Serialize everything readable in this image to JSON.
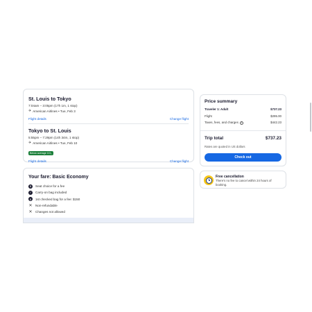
{
  "flights": [
    {
      "title": "St. Louis to Tokyo",
      "time": "7:04am – 3:05pm (17h 1m, 1 stop)",
      "airline": "American Airlines • Tue, Feb 3",
      "details_link": "Flight details",
      "change_link": "Change flight",
      "badge": ""
    },
    {
      "title": "Tokyo to St. Louis",
      "time": "5:55pm – 7:29pm (14h 34m, 1 stop)",
      "airline": "American Airlines • Tue, Feb 10",
      "details_link": "Flight details",
      "change_link": "Change flight",
      "badge": "Below average CO₂"
    }
  ],
  "fare": {
    "title": "Your fare: Basic Economy",
    "features": [
      {
        "icon": "dollar-icon",
        "text": "Seat choice for a fee"
      },
      {
        "icon": "check-icon",
        "text": "Carry-on bag included"
      },
      {
        "icon": "dollar-icon",
        "text": "1st checked bag for a fee: $150"
      },
      {
        "icon": "x-icon",
        "text": "Non-refundable"
      },
      {
        "icon": "x-icon",
        "text": "Changes not allowed"
      }
    ]
  },
  "price_summary": {
    "title": "Price summary",
    "traveler_label": "Traveler 1: Adult",
    "traveler_value": "$737.23",
    "flight_label": "Flight",
    "flight_value": "$295.00",
    "taxes_label": "Taxes, fees, and charges",
    "taxes_value": "$442.23",
    "total_label": "Trip total",
    "total_value": "$737.23",
    "note": "Rates are quoted in US dollars",
    "checkout_label": "Check out"
  },
  "cancellation": {
    "title": "Free cancellation",
    "text": "There's no fee to cancel within 24 hours of booking."
  },
  "colors": {
    "accent": "#1668e3",
    "badge": "#1b7f3a"
  }
}
